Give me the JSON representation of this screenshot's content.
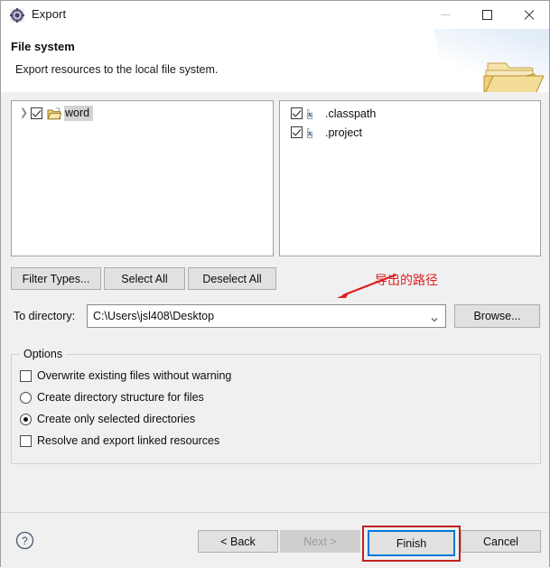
{
  "window": {
    "title": "Export",
    "icon": "export-wizard-icon",
    "controls": {
      "minimize": "—",
      "maximize": "☐",
      "close": "✕"
    }
  },
  "banner": {
    "title": "File system",
    "description": "Export resources to the local file system.",
    "art": "open-folder-with-arrow"
  },
  "trees": {
    "left": {
      "items": [
        {
          "label": "word",
          "checked": true,
          "expandable": true,
          "selected": true,
          "icon": "project-folder-icon"
        }
      ]
    },
    "right": {
      "items": [
        {
          "label": ".classpath",
          "checked": true,
          "icon": "xml-file-icon",
          "icon_glyph": "x"
        },
        {
          "label": ".project",
          "checked": true,
          "icon": "xml-file-icon",
          "icon_glyph": "x"
        }
      ]
    }
  },
  "actions": {
    "filter_types": "Filter Types...",
    "select_all": "Select All",
    "deselect_all": "Deselect All",
    "browse": "Browse..."
  },
  "directory": {
    "label": "To directory:",
    "value": "C:\\Users\\jsl408\\Desktop"
  },
  "options": {
    "legend": "Options",
    "items": [
      {
        "label": "Overwrite existing files without warning",
        "type": "checkbox",
        "checked": false
      },
      {
        "label": "Create directory structure for files",
        "type": "radio",
        "checked": false
      },
      {
        "label": "Create only selected directories",
        "type": "radio",
        "checked": true
      },
      {
        "label": "Resolve and export linked resources",
        "type": "checkbox",
        "checked": false
      }
    ]
  },
  "footer": {
    "help": "?",
    "back": "< Back",
    "next": "Next >",
    "finish": "Finish",
    "cancel": "Cancel"
  },
  "annotations": {
    "path_note": "导出的路径",
    "color": "#e02020",
    "highlight_color": "#c02020",
    "focus_color": "#0078d7"
  }
}
